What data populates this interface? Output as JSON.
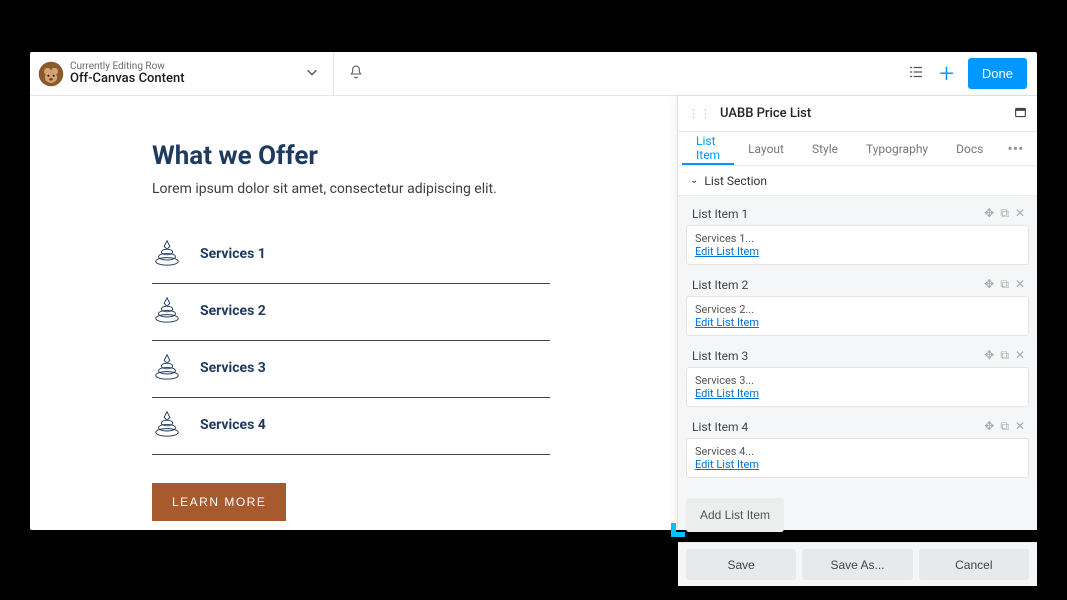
{
  "header": {
    "subtitle": "Currently Editing Row",
    "title": "Off-Canvas Content",
    "done_label": "Done"
  },
  "content": {
    "heading": "What we Offer",
    "subtext": "Lorem ipsum dolor sit amet, consectetur adipiscing elit.",
    "services": [
      {
        "label": "Services 1"
      },
      {
        "label": "Services 2"
      },
      {
        "label": "Services 3"
      },
      {
        "label": "Services 4"
      }
    ],
    "cta_label": "LEARN MORE"
  },
  "panel": {
    "title": "UABB Price List",
    "tabs": [
      {
        "label": "List Item",
        "active": true
      },
      {
        "label": "Layout",
        "active": false
      },
      {
        "label": "Style",
        "active": false
      },
      {
        "label": "Typography",
        "active": false
      },
      {
        "label": "Docs",
        "active": false
      }
    ],
    "section_label": "List Section",
    "items": [
      {
        "title": "List Item 1",
        "summary": "Services 1...",
        "edit": "Edit List Item"
      },
      {
        "title": "List Item 2",
        "summary": "Services 2...",
        "edit": "Edit List Item"
      },
      {
        "title": "List Item 3",
        "summary": "Services 3...",
        "edit": "Edit List Item"
      },
      {
        "title": "List Item 4",
        "summary": "Services 4...",
        "edit": "Edit List Item"
      }
    ],
    "add_label": "Add List Item",
    "footer": {
      "save": "Save",
      "save_as": "Save As...",
      "cancel": "Cancel"
    }
  }
}
